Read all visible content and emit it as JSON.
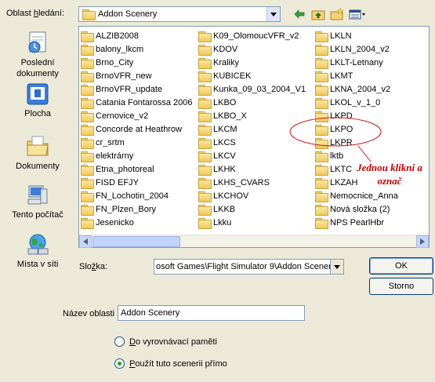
{
  "header": {
    "lookin_label_prefix": "Oblast ",
    "lookin_label_key": "h",
    "lookin_label_suffix": "ledání:",
    "lookin_value": "Addon Scenery"
  },
  "toolbar": {
    "back_icon": "back-arrow-icon",
    "up_icon": "up-folder-icon",
    "new_folder_icon": "new-folder-icon",
    "views_icon": "views-menu-icon"
  },
  "places": [
    {
      "label": "Poslední dokumenty",
      "icon": "recent-documents-icon"
    },
    {
      "label": "Plocha",
      "icon": "desktop-icon"
    },
    {
      "label": "Dokumenty",
      "icon": "my-documents-icon"
    },
    {
      "label": "Tento počítač",
      "icon": "my-computer-icon"
    },
    {
      "label": "Místa v síti",
      "icon": "network-places-icon"
    }
  ],
  "files": {
    "col1": [
      "ALZIB2008",
      "balony_lkcm",
      "Brno_City",
      "BrnoVFR_new",
      "BrnoVFR_update",
      "Catania Fontarossa 2006",
      "Cernovice_v2",
      "Concorde at Heathrow",
      "cr_srtm",
      "elektrárny",
      "Etna_photoreal",
      "FISD EFJY",
      "FN_Lochotin_2004",
      "FN_Plzen_Bory",
      "Jesenicko"
    ],
    "col2": [
      "K09_OlomoucVFR_v2",
      "KDOV",
      "Kraliky",
      "KUBICEK",
      "Kunka_09_03_2004_V1",
      "LKBO",
      "LKBO_X",
      "LKCM",
      "LKCS",
      "LKCV",
      "LKHK",
      "LKHS_CVARS",
      "LKCHOV",
      "LKKB",
      "Lkku"
    ],
    "col3": [
      "LKLN",
      "LKLN_2004_v2",
      "LKLT-Letnany",
      "LKMT",
      "LKNA_2004_v2",
      "LKOL_v_1_0",
      "LKPD",
      "LKPO",
      "LKPR",
      "lktb",
      "LKTC",
      "LKZAH",
      "Nemocnice_Anna",
      "Nová složka (2)",
      "NPS PearlHbr"
    ]
  },
  "folder_field": {
    "label_prefix": "Slo",
    "label_key": "ž",
    "label_suffix": "ka:",
    "value": "osoft Games\\Flight Simulator 9\\Addon Scenery"
  },
  "buttons": {
    "ok": "OK",
    "cancel": "Storno"
  },
  "name_field": {
    "label_prefix": "Název oblasti",
    "value": "Addon Scenery"
  },
  "options": [
    {
      "prefix": "",
      "key": "D",
      "suffix": "o vyrovnávací paměti",
      "checked": false
    },
    {
      "prefix": "",
      "key": "P",
      "suffix": "oužít tuto scenerii přímo",
      "checked": true
    }
  ],
  "annotation": {
    "line1": "Jednou klikni a",
    "line2": "označ",
    "color": "#c00000"
  }
}
